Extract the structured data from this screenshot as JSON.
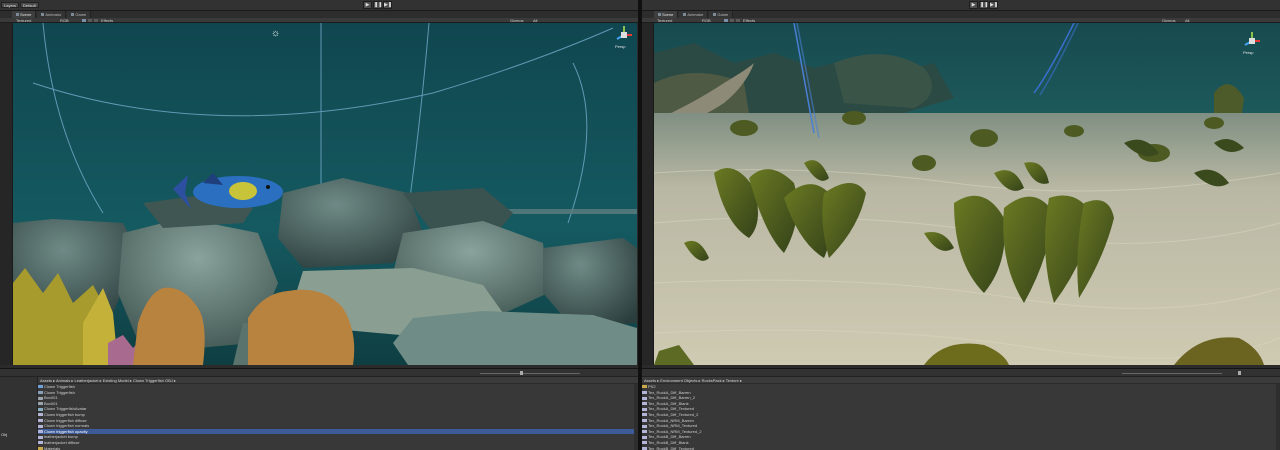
{
  "colors": {
    "left_water": "#13525a",
    "right_water": "#1b4f52",
    "sand": "#bdbaa6",
    "selection": "#3d5a99",
    "gizmo_wire": "#6fa6c6"
  },
  "left": {
    "layout_buttons": [
      "Layers",
      "Default"
    ],
    "play_icons": [
      "▶",
      "❚❚",
      "▶❚"
    ],
    "tabs": [
      {
        "label": "Scene",
        "icon": "scene-icon"
      },
      {
        "label": "Animator",
        "icon": "animator-icon"
      },
      {
        "label": "Game",
        "icon": "game-icon"
      }
    ],
    "scene_toolbar": {
      "mode": "Textured",
      "color": "RGB",
      "effects": "Effects",
      "gizmos": "Gizmos",
      "search": "All"
    },
    "gizmo_label": "Persp",
    "breadcrumb": "Assets ▸ Animals ▸ Leatherjacket ▸ Existing Model ▸ Clown Triggerfish OBJ ▸",
    "assets": [
      {
        "label": "Clown Triggerfish",
        "icon": "prefab-icon"
      },
      {
        "label": "Clown Triggerfish",
        "icon": "mesh-icon"
      },
      {
        "label": "Box001",
        "icon": "object-icon"
      },
      {
        "label": "Box001",
        "icon": "object-icon"
      },
      {
        "label": "Clown TriggerfishAvatar",
        "icon": "avatar-icon"
      },
      {
        "label": "Clown triggerfish bump",
        "icon": "texture-icon"
      },
      {
        "label": "Clown triggerfish diffuse",
        "icon": "texture-icon"
      },
      {
        "label": "Clown triggerfish normals",
        "icon": "texture-icon"
      },
      {
        "label": "Clown triggerfish opacity",
        "icon": "texture-icon",
        "selected": true
      },
      {
        "label": "leatherjacket bump",
        "icon": "texture-icon"
      },
      {
        "label": "leatherjacket diffuse",
        "icon": "texture-icon"
      },
      {
        "label": "Materials",
        "icon": "folder-icon"
      }
    ],
    "left_column_label": "Obj"
  },
  "right": {
    "play_icons": [
      "▶",
      "❚❚",
      "▶❚"
    ],
    "tabs": [
      {
        "label": "Scene",
        "icon": "scene-icon"
      },
      {
        "label": "Animator",
        "icon": "animator-icon"
      },
      {
        "label": "Game",
        "icon": "game-icon"
      }
    ],
    "scene_toolbar": {
      "mode": "Textured",
      "color": "RGB",
      "effects": "Effects",
      "gizmos": "Gizmos",
      "search": "All"
    },
    "gizmo_label": "Persp",
    "breadcrumb": "Assets ▸ Environment Objects ▸ RocksPack ▸ Texture ▸",
    "assets": [
      {
        "label": "PS2",
        "icon": "folder-icon"
      },
      {
        "label": "Tex_RockA_Diff_Barren",
        "icon": "texture-icon"
      },
      {
        "label": "Tex_RockA_Diff_Barren_2",
        "icon": "texture-icon"
      },
      {
        "label": "Tex_RockA_Diff_Blank",
        "icon": "texture-icon"
      },
      {
        "label": "Tex_RockA_Diff_Textured",
        "icon": "texture-icon"
      },
      {
        "label": "Tex_RockA_Diff_Textured_2",
        "icon": "texture-icon"
      },
      {
        "label": "Tex_RockA_NRM_Barren",
        "icon": "texture-icon"
      },
      {
        "label": "Tex_RockA_NRM_Textured",
        "icon": "texture-icon"
      },
      {
        "label": "Tex_RockA_NRM_Textured_2",
        "icon": "texture-icon"
      },
      {
        "label": "Tex_RockB_Diff_Barren",
        "icon": "texture-icon"
      },
      {
        "label": "Tex_RockB_Diff_Blank",
        "icon": "texture-icon"
      },
      {
        "label": "Tex_RockB_Diff_Textured",
        "icon": "texture-icon"
      }
    ]
  }
}
